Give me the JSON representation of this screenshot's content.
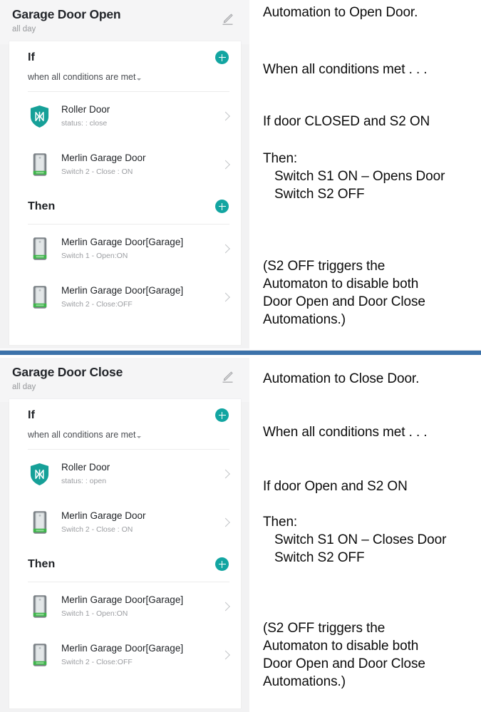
{
  "theme": {
    "accent_teal": "#12a5a1",
    "divider_blue": "#3c72aa",
    "app_bg": "#f2f2f3",
    "card_bg": "#ffffff",
    "text_primary": "#1f2226",
    "text_muted": "#9b9da1"
  },
  "panels": [
    {
      "id": "garage-door-open",
      "header": {
        "title": "Garage Door Open",
        "subtitle": "all day",
        "edit_icon": "pencil-icon"
      },
      "if_section": {
        "title": "If",
        "condition_mode": "when all conditions are met",
        "add_icon": "plus-icon",
        "rows": [
          {
            "icon": "shield-roller-door-icon",
            "name": "Roller Door",
            "status": "status: : close",
            "chevron": "chevron-right-icon"
          },
          {
            "icon": "merlin-remote-icon",
            "name": "Merlin Garage Door",
            "status": "Switch 2 - Close : ON",
            "chevron": "chevron-right-icon"
          }
        ]
      },
      "then_section": {
        "title": "Then",
        "add_icon": "plus-icon",
        "rows": [
          {
            "icon": "merlin-remote-icon",
            "name": "Merlin Garage Door[Garage]",
            "status": "Switch 1 - Open:ON",
            "chevron": "chevron-right-icon"
          },
          {
            "icon": "merlin-remote-icon",
            "name": "Merlin Garage Door[Garage]",
            "status": "Switch 2 - Close:OFF",
            "chevron": "chevron-right-icon"
          }
        ]
      },
      "notes": {
        "headline": "Automation to Open Door.",
        "when": "When all conditions met . . .",
        "condition": "If door CLOSED and S2 ON",
        "then_label": "Then:",
        "then_action_1": "Switch S1 ON – Opens Door",
        "then_action_2": "Switch S2 OFF",
        "footnote": "(S2 OFF triggers the\nAutomaton to disable both\nDoor Open and Door Close\nAutomations.)"
      }
    },
    {
      "id": "garage-door-close",
      "header": {
        "title": "Garage Door Close",
        "subtitle": "all day",
        "edit_icon": "pencil-icon"
      },
      "if_section": {
        "title": "If",
        "condition_mode": "when all conditions are met",
        "add_icon": "plus-icon",
        "rows": [
          {
            "icon": "shield-roller-door-icon",
            "name": "Roller Door",
            "status": "status: : open",
            "chevron": "chevron-right-icon"
          },
          {
            "icon": "merlin-remote-icon",
            "name": "Merlin Garage Door",
            "status": "Switch 2 - Close : ON",
            "chevron": "chevron-right-icon"
          }
        ]
      },
      "then_section": {
        "title": "Then",
        "add_icon": "plus-icon",
        "rows": [
          {
            "icon": "merlin-remote-icon",
            "name": "Merlin Garage Door[Garage]",
            "status": "Switch 1 - Open:ON",
            "chevron": "chevron-right-icon"
          },
          {
            "icon": "merlin-remote-icon",
            "name": "Merlin Garage Door[Garage]",
            "status": "Switch 2 - Close:OFF",
            "chevron": "chevron-right-icon"
          }
        ]
      },
      "notes": {
        "headline": "Automation to Close Door.",
        "when": "When all conditions met . . .",
        "condition": "If door Open and S2 ON",
        "then_label": "Then:",
        "then_action_1": "Switch S1 ON – Closes Door",
        "then_action_2": "Switch S2 OFF",
        "footnote": "(S2 OFF triggers the\nAutomaton to disable both\nDoor Open and Door Close\nAutomations.)"
      }
    }
  ]
}
